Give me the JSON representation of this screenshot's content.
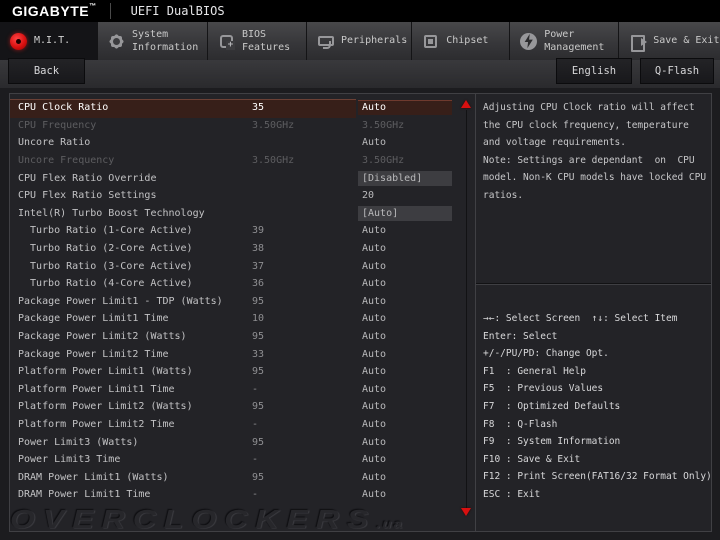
{
  "window": {
    "brand": "GIGABYTE",
    "brand_tm": "™",
    "product": "UEFI DualBIOS"
  },
  "tabs": [
    {
      "label": "M.I.T.",
      "icon": "gauge-icon",
      "active": true
    },
    {
      "label": "System Information",
      "icon": "gear-icon"
    },
    {
      "label": "BIOS Features",
      "icon": "bios-icon"
    },
    {
      "label": "Peripherals",
      "icon": "mouse-icon"
    },
    {
      "label": "Chipset",
      "icon": "chipset-icon"
    },
    {
      "label": "Power Management",
      "icon": "power-icon"
    },
    {
      "label": "Save & Exit",
      "icon": "exit-icon"
    }
  ],
  "toolbar": {
    "back": "Back",
    "language": "English",
    "qflash": "Q-Flash"
  },
  "settings": {
    "rows": [
      {
        "label": "CPU Clock Ratio",
        "mid": "35",
        "value": "Auto",
        "state": "selected",
        "boxed": true
      },
      {
        "label": "CPU Frequency",
        "mid": "3.50GHz",
        "value": "3.50GHz",
        "state": "dimmed"
      },
      {
        "label": "Uncore Ratio",
        "mid": "",
        "value": "Auto"
      },
      {
        "label": "Uncore Frequency",
        "mid": "3.50GHz",
        "value": "3.50GHz",
        "state": "dimmed"
      },
      {
        "label": "CPU Flex Ratio Override",
        "mid": "",
        "value": "[Disabled]",
        "boxed": true
      },
      {
        "label": "CPU Flex Ratio Settings",
        "mid": "",
        "value": "20"
      },
      {
        "label": "Intel(R) Turbo Boost Technology",
        "mid": "",
        "value": "[Auto]",
        "boxed": true
      },
      {
        "label": "Turbo Ratio (1-Core Active)",
        "mid": "39",
        "value": "Auto",
        "indent": true
      },
      {
        "label": "Turbo Ratio (2-Core Active)",
        "mid": "38",
        "value": "Auto",
        "indent": true
      },
      {
        "label": "Turbo Ratio (3-Core Active)",
        "mid": "37",
        "value": "Auto",
        "indent": true
      },
      {
        "label": "Turbo Ratio (4-Core Active)",
        "mid": "36",
        "value": "Auto",
        "indent": true
      },
      {
        "label": "Package Power Limit1 - TDP (Watts)",
        "mid": "95",
        "value": "Auto"
      },
      {
        "label": "Package Power Limit1 Time",
        "mid": "10",
        "value": "Auto"
      },
      {
        "label": "Package Power Limit2 (Watts)",
        "mid": "95",
        "value": "Auto"
      },
      {
        "label": "Package Power Limit2 Time",
        "mid": "33",
        "value": "Auto"
      },
      {
        "label": "Platform Power Limit1 (Watts)",
        "mid": "95",
        "value": "Auto"
      },
      {
        "label": "Platform Power Limit1 Time",
        "mid": "-",
        "value": "Auto"
      },
      {
        "label": "Platform Power Limit2 (Watts)",
        "mid": "95",
        "value": "Auto"
      },
      {
        "label": "Platform Power Limit2 Time",
        "mid": "-",
        "value": "Auto"
      },
      {
        "label": "Power Limit3 (Watts)",
        "mid": "95",
        "value": "Auto"
      },
      {
        "label": "Power Limit3 Time",
        "mid": "-",
        "value": "Auto"
      },
      {
        "label": "DRAM Power Limit1 (Watts)",
        "mid": "95",
        "value": "Auto"
      },
      {
        "label": "DRAM Power Limit1 Time",
        "mid": "-",
        "value": "Auto"
      }
    ]
  },
  "help": {
    "lines": [
      "Adjusting CPU Clock ratio will affect",
      "the CPU clock frequency, temperature",
      "and voltage requirements.",
      "Note: Settings are dependant  on  CPU",
      "model. Non-K CPU models have locked CPU",
      "ratios."
    ]
  },
  "hotkeys": {
    "lines": [
      "→←: Select Screen  ↑↓: Select Item",
      "Enter: Select",
      "+/-/PU/PD: Change Opt.",
      "F1  : General Help",
      "F5  : Previous Values",
      "F7  : Optimized Defaults",
      "F8  : Q-Flash",
      "F9  : System Information",
      "F10 : Save & Exit",
      "F12 : Print Screen(FAT16/32 Format Only)",
      "ESC : Exit"
    ]
  },
  "watermark": {
    "text": "OVERCLOCKERS",
    "suffix": ".ua"
  },
  "colors": {
    "accent_red": "#d81010",
    "selected_row": "#371f19",
    "value_box": "#3d3d41"
  }
}
